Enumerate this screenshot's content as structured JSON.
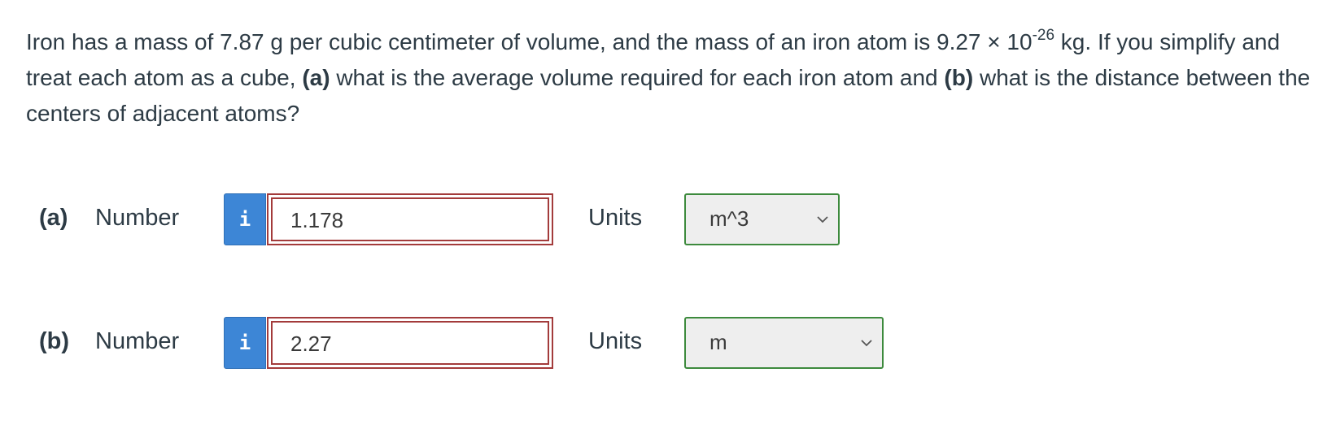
{
  "question": {
    "text_1": "Iron has a mass of 7.87 g per cubic centimeter of volume, and the mass of an iron atom is 9.27 × 10",
    "exponent": "-26",
    "text_2": " kg. If you simplify and treat each atom as a cube, ",
    "part_a_marker": "(a)",
    "text_3": " what is the average volume required for each iron atom and ",
    "part_b_marker": "(b)",
    "text_4": " what is the distance between the centers of adjacent atoms?"
  },
  "parts": [
    {
      "label": "(a)",
      "number_label": "Number",
      "info_icon": "i",
      "value": "1.178",
      "units_label": "Units",
      "unit_selected": "m^3"
    },
    {
      "label": "(b)",
      "number_label": "Number",
      "info_icon": "i",
      "value": "2.27",
      "units_label": "Units",
      "unit_selected": "m"
    }
  ],
  "colors": {
    "text": "#2d3b45",
    "info_button": "#3d86d6",
    "incorrect_border": "#a33b3b",
    "select_border": "#3d8a3d",
    "select_bg": "#eeeeee"
  }
}
